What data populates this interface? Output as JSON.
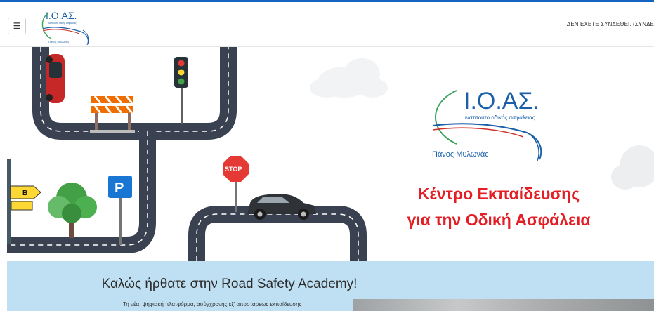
{
  "header": {
    "menu_icon": "hamburger-icon",
    "logo_text": "Ι.Ο.ΑΣ.",
    "logo_subtitle": "ινστιτούτο οδικής ασφάλειας",
    "logo_signature": "Πάνος Μυλωνάς",
    "login_status": "ΔΕΝ ΕΧΕΤΕ ΣΥΝΔΕΘΕΙ. (ΣΥΝΔΕ"
  },
  "hero": {
    "logo_text": "Ι.Ο.ΑΣ.",
    "logo_subtitle": "ινστιτούτο οδικής ασφάλειας",
    "logo_signature": "Πάνος Μυλωνάς",
    "headline_line1": "Κέντρο Εκπαίδευσης",
    "headline_line2": "για την Οδική Ασφάλεια",
    "stop_sign": "STOP",
    "parking_sign": "P",
    "direction_sign": "B",
    "colors": {
      "headline": "#e31e24",
      "road": "#3a4150",
      "logo_blue": "#1a5fa8",
      "logo_green": "#3aa35b",
      "logo_red": "#d0312d"
    }
  },
  "welcome": {
    "title": "Καλώς ήρθατε στην Road Safety Academy!",
    "text": "Τη νέα, ψηφιακή πλατφόρμα, ασύγχρονης εξ' αποστάσεως εκπαίδευσης"
  }
}
